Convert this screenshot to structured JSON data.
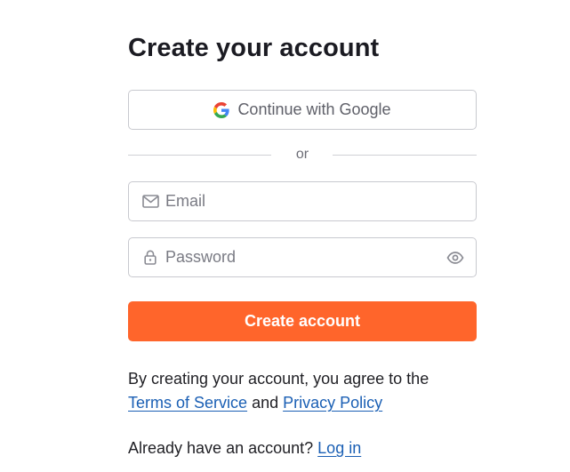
{
  "signup": {
    "title": "Create your account",
    "google_button": {
      "label": "Continue with Google",
      "icon": "google-g-icon",
      "icon_colors": [
        "#4285F4",
        "#34A853",
        "#FBBC05",
        "#EA4335"
      ]
    },
    "divider_text": "or",
    "email": {
      "placeholder": "Email",
      "value": "",
      "icon": "mail-icon"
    },
    "password": {
      "placeholder": "Password",
      "value": "",
      "icon": "lock-icon",
      "toggle_icon": "eye-icon"
    },
    "submit_label": "Create account",
    "terms": {
      "prefix": "By creating your account, you agree to the",
      "tos_link": "Terms of Service",
      "conjunction": "and",
      "privacy_link": "Privacy Policy"
    },
    "login": {
      "prompt": "Already have an account?",
      "link": "Log in"
    }
  },
  "colors": {
    "accent": "#ff652b",
    "link": "#1a5fb4",
    "border": "#c8c9cf",
    "text": "#1f1f24",
    "muted": "#7a7b84"
  }
}
